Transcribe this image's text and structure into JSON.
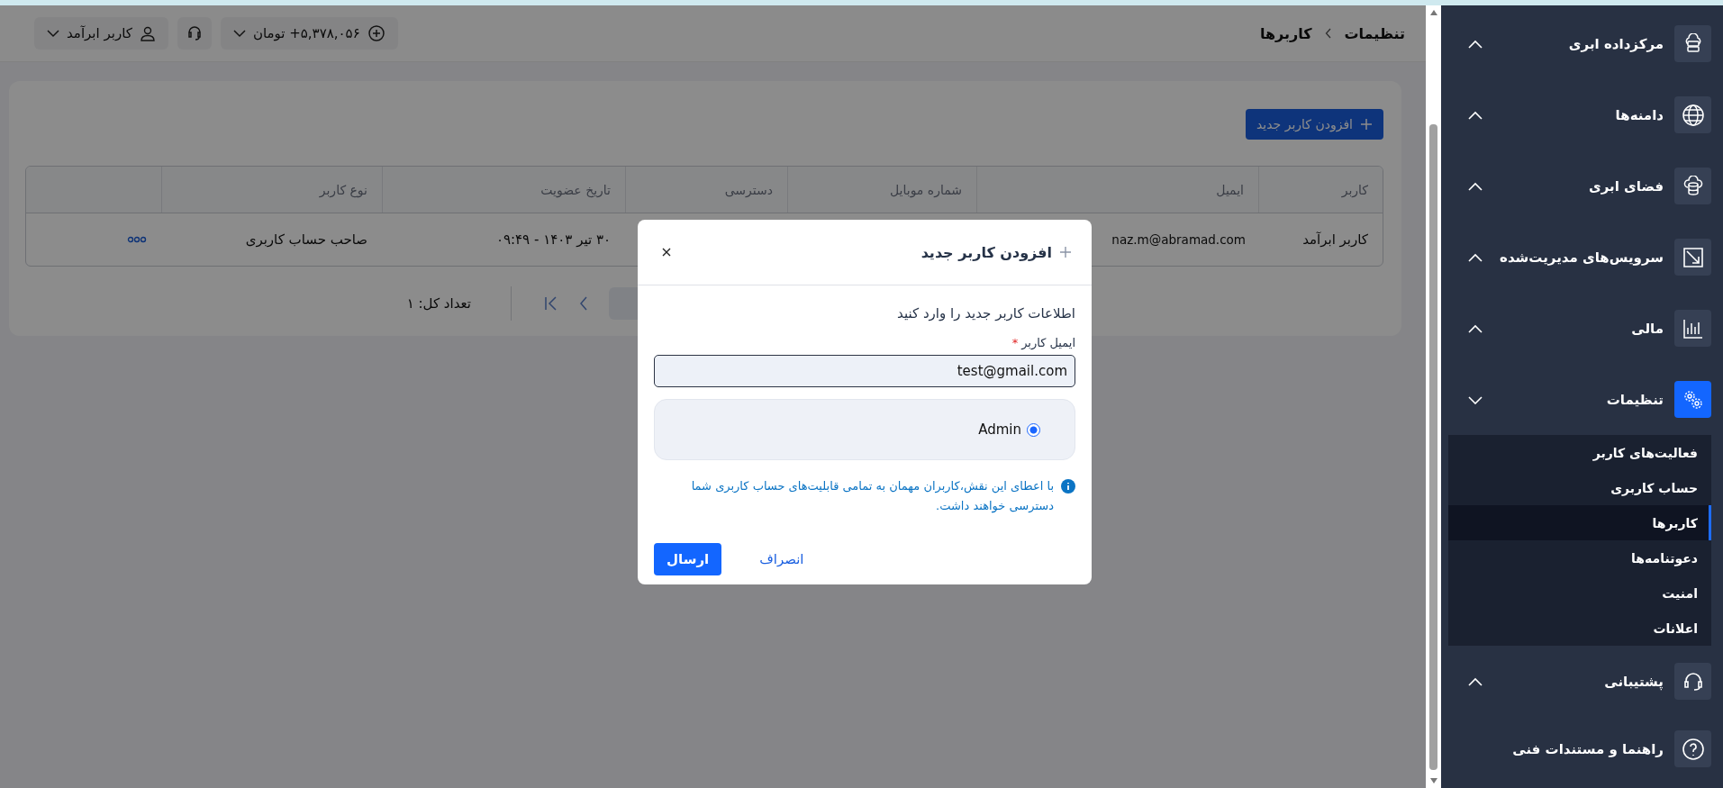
{
  "topbar": {
    "breadcrumb": [
      {
        "label": "تنظیمات"
      },
      {
        "label": "کاربرها"
      }
    ],
    "balance": {
      "label": "۵,۳۷۸,۰۵۶+ تومان"
    },
    "user_menu": {
      "label": "کاربر ابرآمد"
    }
  },
  "sidebar": {
    "items": [
      {
        "label": "مرکزداده ابری",
        "kind": "group",
        "expanded": false,
        "selected": false
      },
      {
        "label": "دامنه‌ها",
        "kind": "group",
        "expanded": false,
        "selected": false
      },
      {
        "label": "فضای ابری",
        "kind": "group",
        "expanded": false,
        "selected": false
      },
      {
        "label": "سرویس‌های مدیریت‌شده",
        "kind": "group",
        "expanded": false,
        "selected": false
      },
      {
        "label": "مالی",
        "kind": "group",
        "expanded": false,
        "selected": false
      },
      {
        "label": "تنظیمات",
        "kind": "group",
        "expanded": true,
        "selected": true,
        "children": [
          {
            "label": "فعالیت‌های کاربر",
            "selected": false
          },
          {
            "label": "حساب کاربری",
            "selected": false
          },
          {
            "label": "کاربرها",
            "selected": true
          },
          {
            "label": "دعوتنامه‌ها",
            "selected": false
          },
          {
            "label": "امنیت",
            "selected": false
          },
          {
            "label": "اعلانات",
            "selected": false
          }
        ]
      },
      {
        "label": "پشتیبانی",
        "kind": "group",
        "expanded": false,
        "selected": false
      },
      {
        "label": "راهنما و مستندات فنی",
        "kind": "link",
        "selected": false
      }
    ]
  },
  "page": {
    "add_button": "افزودن کاربر جدید",
    "table": {
      "columns": [
        "کاربر",
        "ایمیل",
        "شماره موبایل",
        "دسترسی",
        "تاریخ عضویت",
        "نوع کاربر"
      ],
      "rows": [
        {
          "user": "کاربر ابرآمد",
          "email": "naz.m@abramad.com",
          "joined": "۳۰ تیر ۱۴۰۳ - ۰۹:۴۹",
          "user_type": "صاحب حساب کاربری"
        }
      ]
    },
    "pagination": {
      "total": "تعداد کل: ۱"
    }
  },
  "modal": {
    "title": "افزودن کاربر جدید",
    "subtitle": "اطلاعات کاربر جدید را وارد کنید",
    "email_label": "ایمیل کاربر",
    "required_mark": "*",
    "email_value": "test@gmail.com",
    "roles": [
      {
        "label": "Admin",
        "selected": true
      }
    ],
    "note": "با اعطای این نقش،کاربران مهمان به تمامی قابلیت‌های حساب کاربری شما دسترسی خواهند داشت.",
    "cancel": "انصراف",
    "submit": "ارسال"
  }
}
